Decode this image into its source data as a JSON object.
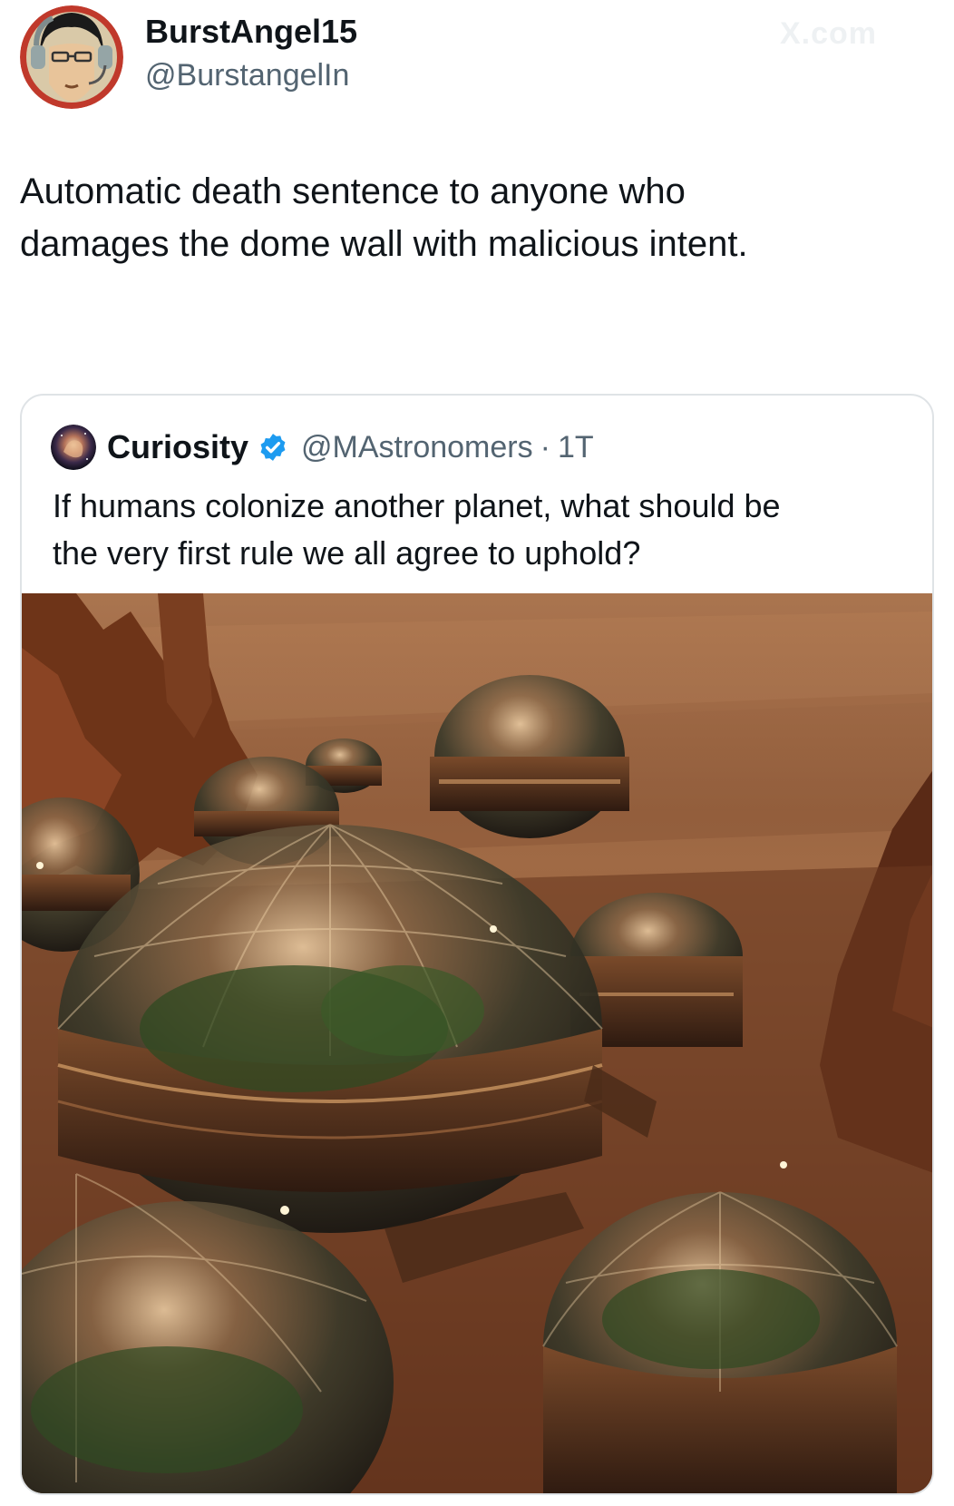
{
  "author": {
    "display_name": "BurstAngel15",
    "handle": "@BurstangelIn",
    "avatar_icon": "anime-character-avatar-icon"
  },
  "watermark": "X.com",
  "tweet": {
    "line1": "Automatic death sentence to anyone who",
    "line2": "damages the dome wall with malicious intent."
  },
  "quote": {
    "display_name": "Curiosity",
    "verified_icon": "verified-badge-icon",
    "handle": "@MAstronomers",
    "separator": "·",
    "time": "1T",
    "line1": "If humans colonize another planet, what should be",
    "line2": "the very first rule we all agree to uphold?",
    "image": "mars-dome-colony-image"
  },
  "colors": {
    "text": "#0f1419",
    "secondary": "#536471",
    "verified": "#1d9bf0",
    "border": "#dfe3e6"
  }
}
